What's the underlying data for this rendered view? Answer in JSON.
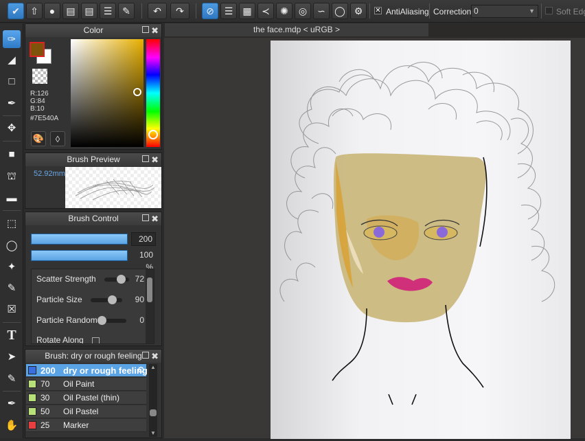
{
  "toolbar": {
    "antialiasing_label": "AntiAliasing",
    "antialiasing_checked": true,
    "correction_label": "Correction",
    "correction_value": "0",
    "soft_edge_label": "Soft Edg",
    "soft_edge_checked": false
  },
  "color_panel": {
    "title": "Color",
    "r": "R:126",
    "g": "G:84",
    "b": "B:10",
    "hex": "#7E540A",
    "foreground": "#7E540A"
  },
  "brush_preview": {
    "title": "Brush Preview",
    "size": "52.92mm"
  },
  "brush_control": {
    "title": "Brush Control",
    "size_value": "200",
    "opacity_value": "100 %",
    "params": [
      {
        "label": "Scatter Strength",
        "value": "72",
        "level": 0.72
      },
      {
        "label": "Particle Size",
        "value": "90",
        "level": 0.9
      },
      {
        "label": "Particle Random",
        "value": "0",
        "level": 0.0
      },
      {
        "label": "Rotate Along",
        "value": ""
      }
    ]
  },
  "brush_list": {
    "title": "Brush: dry or rough feeling",
    "items": [
      {
        "size": "200",
        "name": "dry or rough feeling",
        "color": "#3b6fe0",
        "selected": true
      },
      {
        "size": "70",
        "name": "Oil Paint",
        "color": "#b8e07a",
        "selected": false
      },
      {
        "size": "30",
        "name": "Oil Pastel (thin)",
        "color": "#b8e07a",
        "selected": false
      },
      {
        "size": "50",
        "name": "Oil Pastel",
        "color": "#b8e07a",
        "selected": false
      },
      {
        "size": "25",
        "name": "Marker",
        "color": "#e84040",
        "selected": false
      }
    ]
  },
  "canvas": {
    "document_tab": "the face.mdp < uRGB >"
  }
}
